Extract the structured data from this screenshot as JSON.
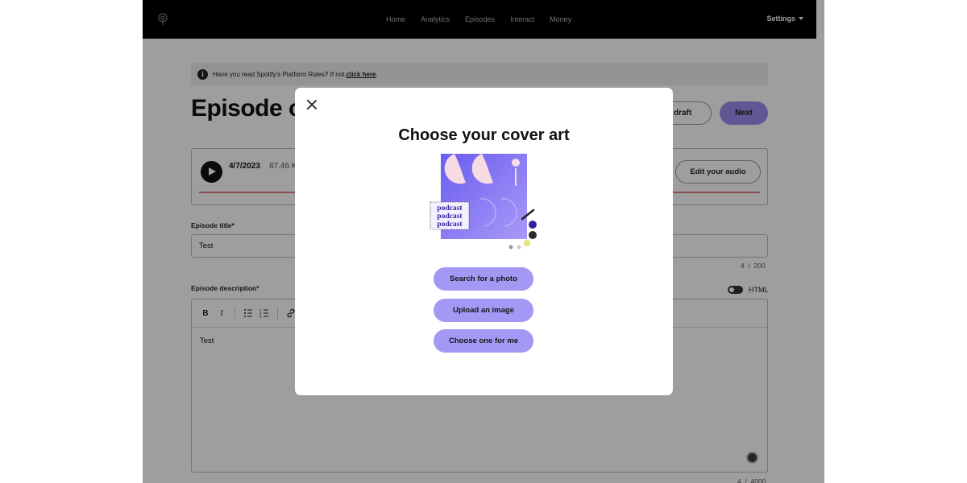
{
  "nav": {
    "items": [
      "Home",
      "Analytics",
      "Episodes",
      "Interact",
      "Money"
    ],
    "settings": "Settings"
  },
  "banner": {
    "text": "Have you read Spotify's Platform Rules? If not, ",
    "link": "click here",
    "suffix": "."
  },
  "page": {
    "title": "Episode options",
    "draft_label": "s draft",
    "next_label": "Next"
  },
  "audio": {
    "date": "4/7/2023",
    "size": "87.46 K",
    "edit_label": "Edit your audio"
  },
  "episode_title": {
    "label": "Episode title*",
    "value": "Test",
    "count": "4",
    "max": "200"
  },
  "episode_description": {
    "label": "Episode description*",
    "html_toggle": "HTML",
    "value": "Test",
    "count": "4",
    "max": "4000"
  },
  "modal": {
    "title": "Choose your cover art",
    "art_text": [
      "podcast",
      "podcast",
      "podcast"
    ],
    "buttons": {
      "search": "Search for a photo",
      "upload": "Upload an image",
      "choose": "Choose one for me"
    }
  },
  "colors": {
    "accent": "#a399f5",
    "next_button": "#9b8ef0",
    "art_background": "#7b6ff0",
    "waveform": "#e08080"
  }
}
